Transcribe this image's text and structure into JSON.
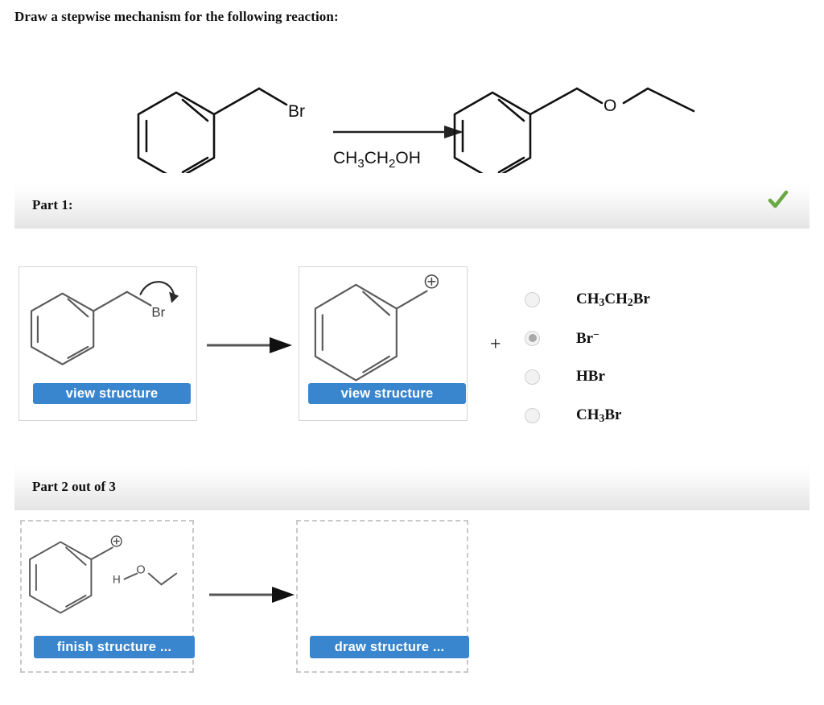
{
  "prompt": "Draw a stepwise mechanism for the following reaction:",
  "reaction_scheme": {
    "reactant_label": "Br",
    "reagent_label": "CH3CH2OH",
    "reagent_text": "CH₃CH₂OH",
    "product_atom_label": "O",
    "arrow": "reaction-arrow-right"
  },
  "parts": [
    {
      "id": "part1",
      "title": "Part 1:",
      "status": "correct",
      "status_icon": "green-check-icon",
      "left_panel": {
        "structure": "benzyl-bromide-with-curved-arrow",
        "atom_labels": [
          "Br"
        ],
        "button_label": "view structure",
        "border_style": "solid"
      },
      "right_panel": {
        "structure": "benzyl-cation",
        "charge_label": "⊕",
        "button_label": "view structure",
        "border_style": "solid"
      },
      "plus": "+",
      "options": [
        {
          "label_html": "CH<sub>3</sub>CH<sub>2</sub>Br",
          "label_text": "CH3CH2Br",
          "selected": false
        },
        {
          "label_html": "Br<sup>−</sup>",
          "label_text": "Br-",
          "selected": true
        },
        {
          "label_html": "HBr",
          "label_text": "HBr",
          "selected": false
        },
        {
          "label_html": "CH<sub>3</sub>Br",
          "label_text": "CH3Br",
          "selected": false
        }
      ]
    },
    {
      "id": "part2",
      "title": "Part 2 out of 3",
      "status": "pending",
      "status_icon": null,
      "left_panel": {
        "structure": "benzyl-cation-plus-ethanol",
        "atom_labels": [
          "H",
          "O"
        ],
        "charge_label": "⊕",
        "button_label": "finish structure ...",
        "border_style": "dashed"
      },
      "right_panel": {
        "structure": "empty",
        "button_label": "draw structure ...",
        "border_style": "dashed"
      }
    }
  ],
  "colors": {
    "button_blue": "#3a86ce",
    "check_green": "#6aa845",
    "header_gray": "#e8e8e8",
    "panel_border": "#d5d5d5",
    "dashed_border": "#c9c9c9",
    "bond_stroke": "#4a4a4a",
    "scheme_stroke": "#111111"
  }
}
